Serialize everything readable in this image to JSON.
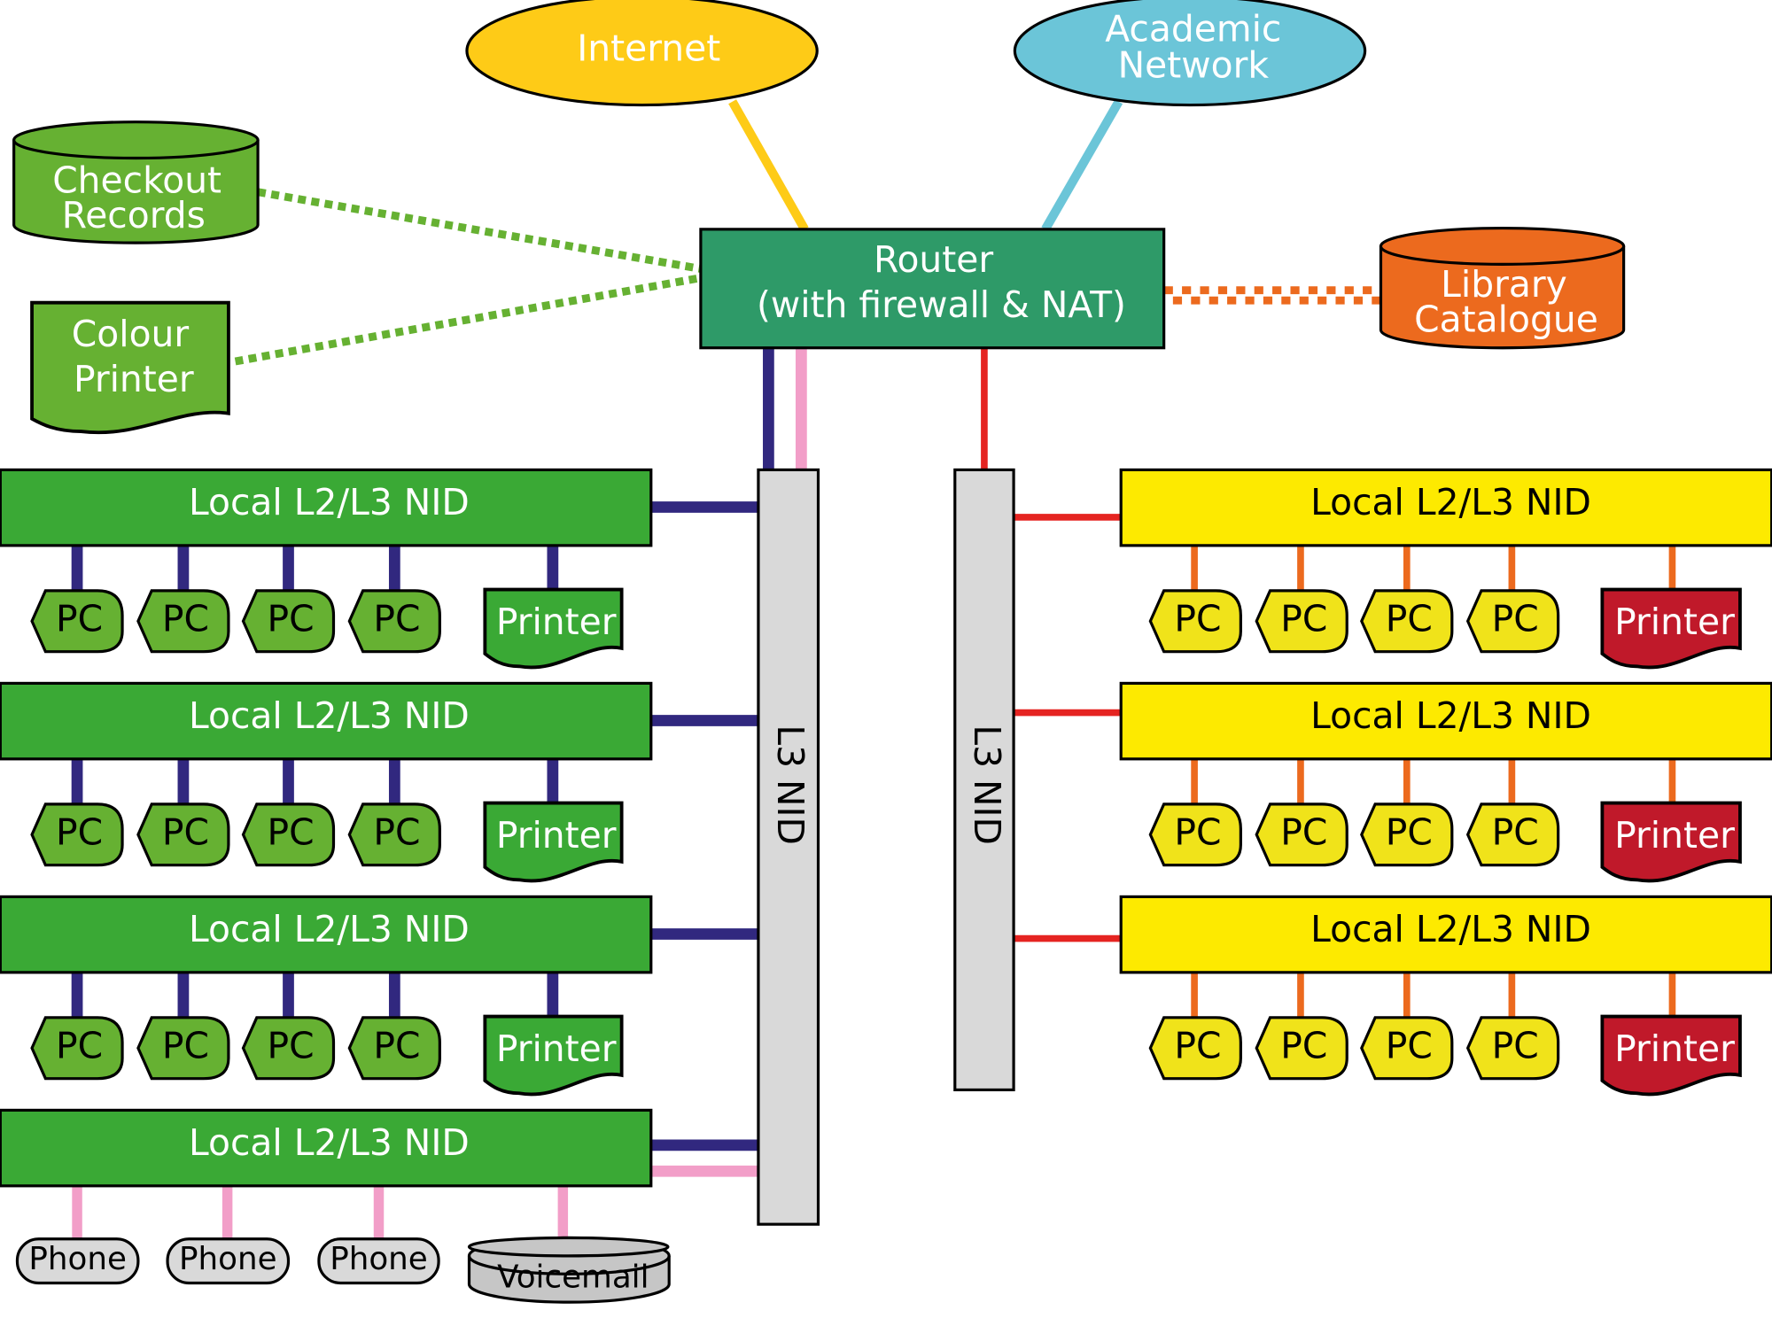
{
  "colors": {
    "internet": "#FECB17",
    "academic": "#6BC5D8",
    "router": "#2E9A68",
    "green_dotted": "#66B132",
    "catalogue": "#EC6A1E",
    "navy": "#31287F",
    "pink": "#F29EC8",
    "red": "#E52421",
    "orange": "#EC6A1E",
    "nid_gray": "#D9D9D9",
    "local_green": "#3AA935",
    "pc_green": "#66B132",
    "local_yellow": "#FDEA00",
    "pc_yellow": "#F0E31A",
    "printer_red": "#C0192A",
    "voicemail": "#C6C6C6"
  },
  "internet": {
    "label": "Internet"
  },
  "academic": {
    "lines": [
      "Academic",
      "Network"
    ]
  },
  "router": {
    "lines": [
      "Router",
      "(with firewall & NAT)"
    ]
  },
  "checkout": {
    "lines": [
      "Checkout",
      "Records"
    ]
  },
  "colour_printer": {
    "lines": [
      "Colour",
      "Printer"
    ]
  },
  "catalogue": {
    "lines": [
      "Library",
      "Catalogue"
    ]
  },
  "l3_left": {
    "label": "L3 NID"
  },
  "l3_right": {
    "label": "L3 NID"
  },
  "left_local": [
    {
      "label": "Local L2/L3 NID",
      "pcs": [
        "PC",
        "PC",
        "PC",
        "PC"
      ],
      "printer": "Printer"
    },
    {
      "label": "Local L2/L3 NID",
      "pcs": [
        "PC",
        "PC",
        "PC",
        "PC"
      ],
      "printer": "Printer"
    },
    {
      "label": "Local L2/L3 NID",
      "pcs": [
        "PC",
        "PC",
        "PC",
        "PC"
      ],
      "printer": "Printer"
    },
    {
      "label": "Local L2/L3 NID",
      "phones": [
        "Phone",
        "Phone",
        "Phone"
      ],
      "voicemail": "Voicemail"
    }
  ],
  "right_local": [
    {
      "label": "Local L2/L3 NID",
      "pcs": [
        "PC",
        "PC",
        "PC",
        "PC"
      ],
      "printer": "Printer"
    },
    {
      "label": "Local L2/L3 NID",
      "pcs": [
        "PC",
        "PC",
        "PC",
        "PC"
      ],
      "printer": "Printer"
    },
    {
      "label": "Local L2/L3 NID",
      "pcs": [
        "PC",
        "PC",
        "PC",
        "PC"
      ],
      "printer": "Printer"
    }
  ]
}
